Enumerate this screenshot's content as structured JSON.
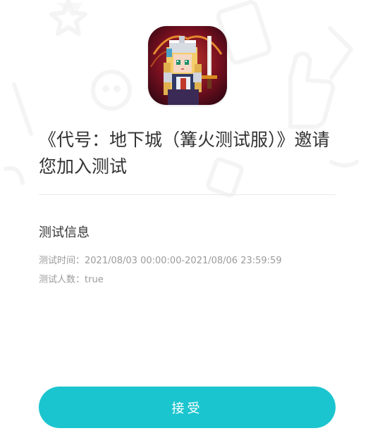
{
  "app": {
    "icon_name": "game-app-icon"
  },
  "invite": {
    "title": "《代号：地下城（篝火测试服）》邀请您加入测试"
  },
  "test_info": {
    "section_title": "测试信息",
    "time_label": "测试时间：",
    "time_value": "2021/08/03 00:00:00-2021/08/06 23:59:59",
    "count_label": "测试人数：",
    "count_value": "true"
  },
  "actions": {
    "accept_label": "接受"
  },
  "colors": {
    "accent": "#1bc5cf",
    "text_primary": "#333333",
    "text_secondary": "#9b9b9b",
    "divider": "#e9e9e9"
  }
}
